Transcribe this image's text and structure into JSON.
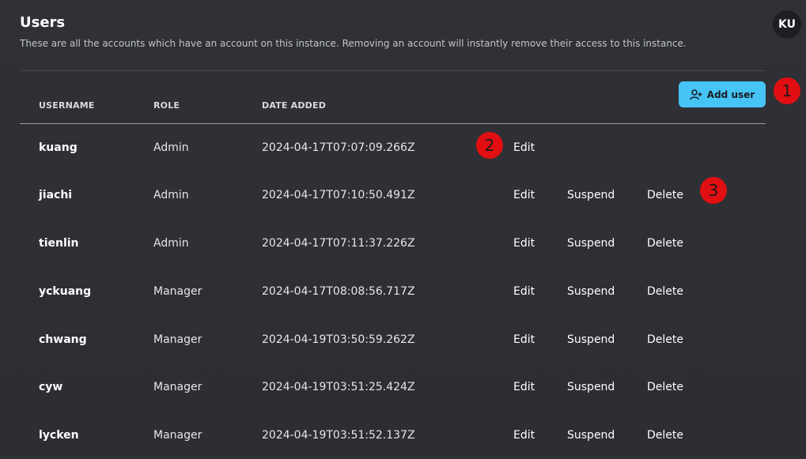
{
  "header": {
    "title": "Users",
    "subtitle": "These are all the accounts which have an account on this instance. Removing an account will instantly remove their access to this instance.",
    "avatar_initials": "KU"
  },
  "toolbar": {
    "add_user_label": "Add user",
    "add_user_icon": "user-plus-icon",
    "accent_color": "#46c4f5"
  },
  "table": {
    "columns": [
      "USERNAME",
      "ROLE",
      "DATE ADDED"
    ],
    "rows": [
      {
        "username": "kuang",
        "role": "Admin",
        "date": "2024-04-17T07:07:09.266Z",
        "actions": [
          "Edit"
        ]
      },
      {
        "username": "jiachi",
        "role": "Admin",
        "date": "2024-04-17T07:10:50.491Z",
        "actions": [
          "Edit",
          "Suspend",
          "Delete"
        ]
      },
      {
        "username": "tienlin",
        "role": "Admin",
        "date": "2024-04-17T07:11:37.226Z",
        "actions": [
          "Edit",
          "Suspend",
          "Delete"
        ]
      },
      {
        "username": "yckuang",
        "role": "Manager",
        "date": "2024-04-17T08:08:56.717Z",
        "actions": [
          "Edit",
          "Suspend",
          "Delete"
        ]
      },
      {
        "username": "chwang",
        "role": "Manager",
        "date": "2024-04-19T03:50:59.262Z",
        "actions": [
          "Edit",
          "Suspend",
          "Delete"
        ]
      },
      {
        "username": "cyw",
        "role": "Manager",
        "date": "2024-04-19T03:51:25.424Z",
        "actions": [
          "Edit",
          "Suspend",
          "Delete"
        ]
      },
      {
        "username": "lycken",
        "role": "Manager",
        "date": "2024-04-19T03:51:52.137Z",
        "actions": [
          "Edit",
          "Suspend",
          "Delete"
        ]
      }
    ]
  },
  "annotations": {
    "markers": [
      "1",
      "2",
      "3"
    ],
    "marker_color": "#e10f12"
  }
}
